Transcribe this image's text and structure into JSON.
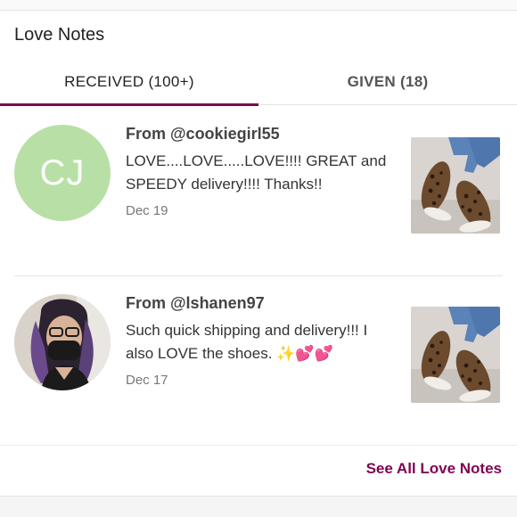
{
  "card": {
    "title": "Love Notes"
  },
  "tabs": [
    {
      "label": "RECEIVED (100+)",
      "active": true
    },
    {
      "label": "GIVEN (18)",
      "active": false
    }
  ],
  "notes": [
    {
      "from": "From @cookiegirl55",
      "avatar_initials": "CJ",
      "text": "LOVE....LOVE.....LOVE!!!! GREAT and SPEEDY delivery!!!! Thanks!!",
      "date": "Dec 19"
    },
    {
      "from": "From @lshanen97",
      "text": "Such quick shipping and delivery!!! I also LOVE the shoes. ✨💕💕",
      "date": "Dec 17"
    }
  ],
  "footer": {
    "see_all_label": "See All Love Notes"
  },
  "colors": {
    "accent": "#7f0353",
    "avatar_green": "#b8e0a6"
  }
}
